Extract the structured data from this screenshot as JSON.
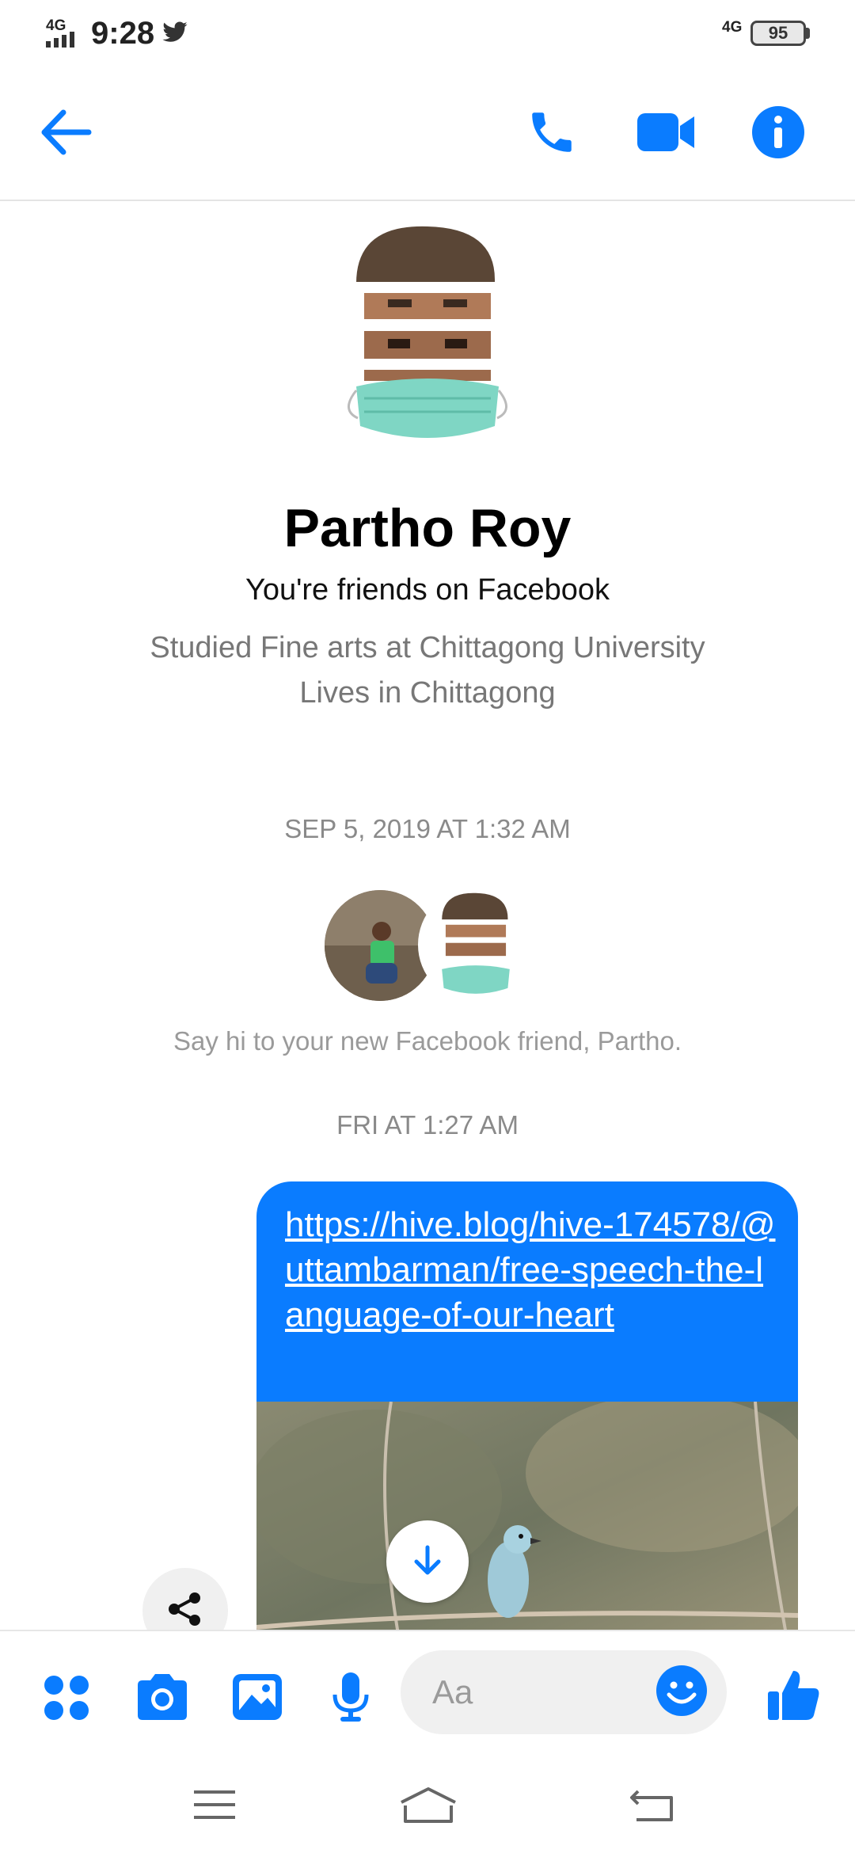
{
  "status_bar": {
    "network": "4G",
    "time": "9:28",
    "network_right": "4G",
    "battery": "95",
    "notification_icon": "twitter-icon"
  },
  "header": {
    "back_icon": "back-arrow-icon",
    "call_icon": "phone-icon",
    "video_icon": "video-camera-icon",
    "info_icon": "info-icon",
    "accent_color": "#0a7cff"
  },
  "profile": {
    "name": "Partho Roy",
    "relationship": "You're friends on Facebook",
    "studied": "Studied Fine arts at Chittagong University",
    "lives": "Lives in Chittagong"
  },
  "conversation": {
    "timestamp_1": "SEP 5, 2019 AT 1:32 AM",
    "say_hi": "Say hi to your new Facebook friend, Partho.",
    "timestamp_2": "FRI AT 1:27 AM",
    "message_link": "https://hive.blog/hive-174578/@uttambarman/free-speech-the-language-of-our-heart"
  },
  "composer": {
    "placeholder": "Aa",
    "icons": [
      "apps-icon",
      "camera-icon",
      "gallery-icon",
      "microphone-icon",
      "emoji-icon",
      "thumbs-up-icon"
    ]
  },
  "nav_bar": {
    "icons": [
      "menu-icon",
      "home-icon",
      "back-icon"
    ]
  }
}
